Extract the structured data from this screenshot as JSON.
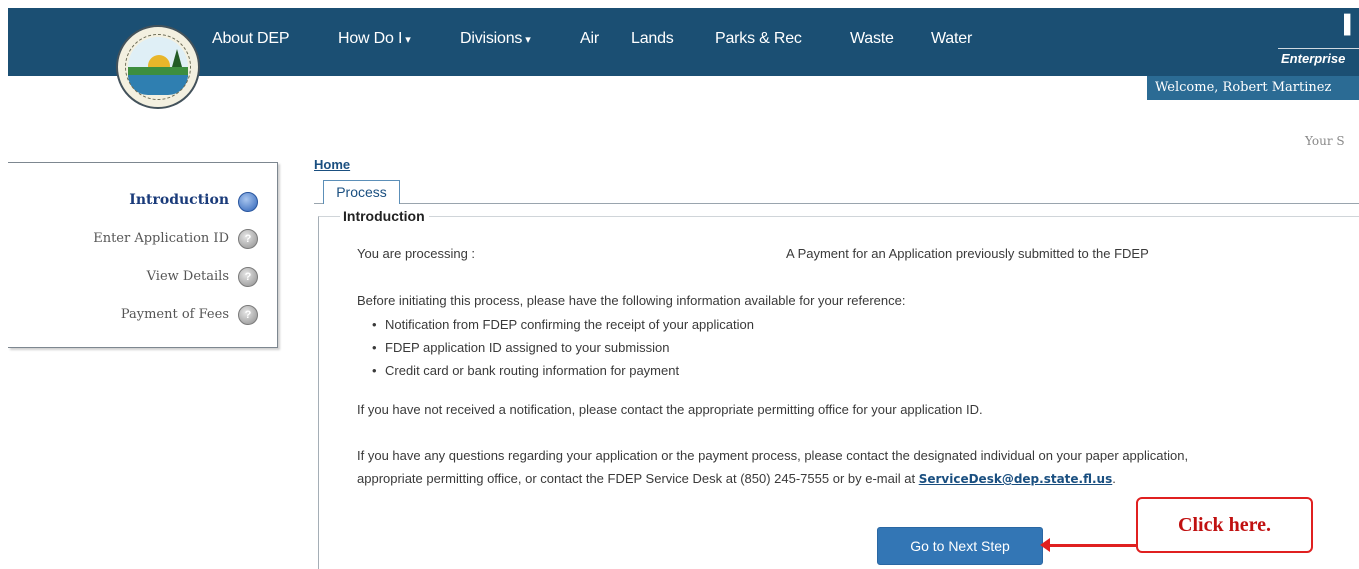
{
  "header": {
    "nav": [
      {
        "label": "About DEP",
        "dropdown": false
      },
      {
        "label": "How Do I",
        "dropdown": true
      },
      {
        "label": "Divisions",
        "dropdown": true
      },
      {
        "label": "Air",
        "dropdown": false
      },
      {
        "label": "Lands",
        "dropdown": false
      },
      {
        "label": "Parks & Rec",
        "dropdown": false
      },
      {
        "label": "Waste",
        "dropdown": false
      },
      {
        "label": "Water",
        "dropdown": false
      }
    ],
    "dropdown_caret": "▾",
    "enterprise_label": "Enterprise",
    "welcome_text": "Welcome, Robert Martinez",
    "your_sub": "Your S",
    "color_bar": "#1b4f73",
    "color_welcome": "#2b6b94"
  },
  "sidebar": {
    "steps": [
      {
        "label": "Introduction",
        "active": true,
        "icon": "current-step-icon"
      },
      {
        "label": "Enter Application ID",
        "active": false,
        "icon": "pending-step-icon"
      },
      {
        "label": "View Details",
        "active": false,
        "icon": "pending-step-icon"
      },
      {
        "label": "Payment of Fees",
        "active": false,
        "icon": "pending-step-icon"
      }
    ],
    "pending_glyph": "?"
  },
  "breadcrumb": {
    "home": "Home"
  },
  "tabs": [
    {
      "label": "Process",
      "selected": true
    }
  ],
  "main": {
    "section_title": "Introduction",
    "processing_label": "You are processing :",
    "processing_value": "A Payment for an Application previously submitted to the FDEP",
    "before_text": "Before initiating this process, please have the following information available for your reference:",
    "requirements": [
      "Notification from FDEP confirming the receipt of your application",
      "FDEP application ID assigned to your submission",
      "Credit card or bank routing information for payment"
    ],
    "no_notification_text": "If you have not received a notification, please contact the appropriate permitting office for your application ID.",
    "questions_line1": "If you have any questions regarding your application or the payment process, please contact the designated individual on your paper application,",
    "questions_line2_prefix": "appropriate permitting office, or contact the FDEP Service Desk at (850) 245-7555 or by e-mail at",
    "email": "ServiceDesk@dep.state.fl.us",
    "questions_line2_suffix": ".",
    "next_button": "Go to Next Step",
    "button_color": "#3376b5"
  },
  "annotation": {
    "callout_text": "Click here.",
    "color": "#e02020"
  }
}
